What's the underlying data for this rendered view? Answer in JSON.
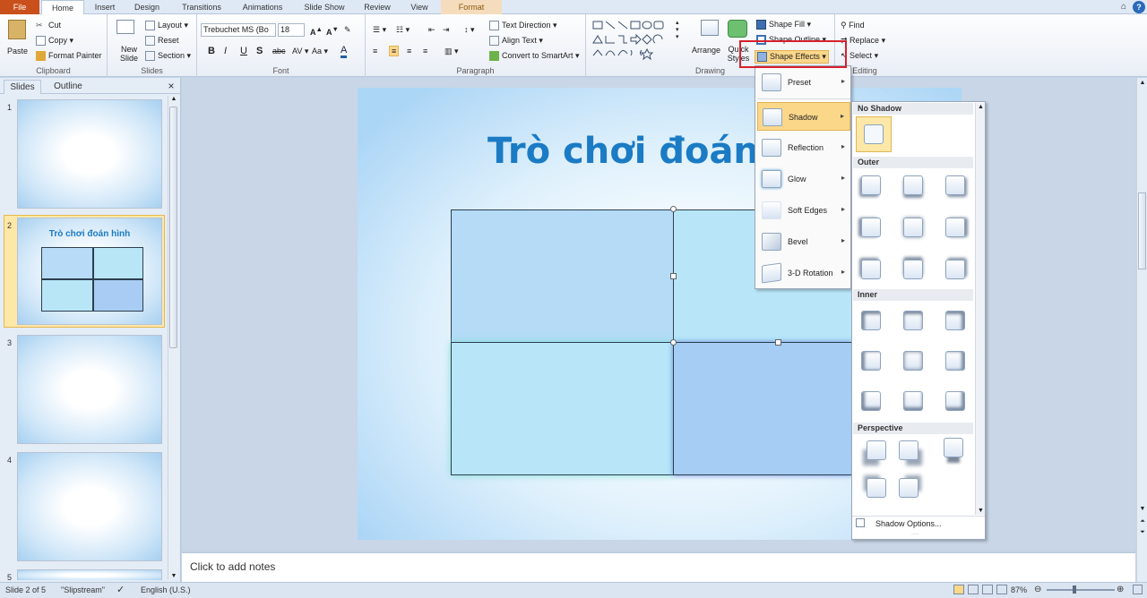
{
  "tabs": [
    "File",
    "Home",
    "Insert",
    "Design",
    "Transitions",
    "Animations",
    "Slide Show",
    "Review",
    "View",
    "Format"
  ],
  "clipboard": {
    "paste": "Paste",
    "cut": "Cut",
    "copy": "Copy",
    "format_painter": "Format Painter",
    "label": "Clipboard"
  },
  "slides_group": {
    "new_slide": "New Slide",
    "layout": "Layout",
    "reset": "Reset",
    "section": "Section",
    "label": "Slides"
  },
  "font": {
    "name": "Trebuchet MS (Bo",
    "size": "18",
    "label": "Font"
  },
  "paragraph": {
    "text_direction": "Text Direction",
    "align_text": "Align Text",
    "convert": "Convert to SmartArt",
    "label": "Paragraph"
  },
  "drawing": {
    "arrange": "Arrange",
    "quick_styles": "Quick Styles",
    "shape_fill": "Shape Fill",
    "shape_outline": "Shape Outline",
    "shape_effects": "Shape Effects",
    "label": "Drawing"
  },
  "editing": {
    "find": "Find",
    "replace": "Replace",
    "select": "Select",
    "label": "Editing"
  },
  "pane": {
    "slides_tab": "Slides",
    "outline_tab": "Outline",
    "close": "×",
    "thumbs": [
      "1",
      "2",
      "3",
      "4",
      "5"
    ],
    "thumb2_title": "Trò chơi đoán hình"
  },
  "slide": {
    "title": "Trò chơi đoán"
  },
  "notes": "Click to add notes",
  "status": {
    "slide": "Slide 2 of 5",
    "theme": "\"Slipstream\"",
    "lang": "English (U.S.)",
    "zoom": "87%"
  },
  "effects_menu": [
    "Preset",
    "Shadow",
    "Reflection",
    "Glow",
    "Soft Edges",
    "Bevel",
    "3-D Rotation"
  ],
  "shadow_panel": {
    "no_shadow": "No Shadow",
    "outer": "Outer",
    "inner": "Inner",
    "perspective": "Perspective",
    "options": "Shadow Options..."
  }
}
